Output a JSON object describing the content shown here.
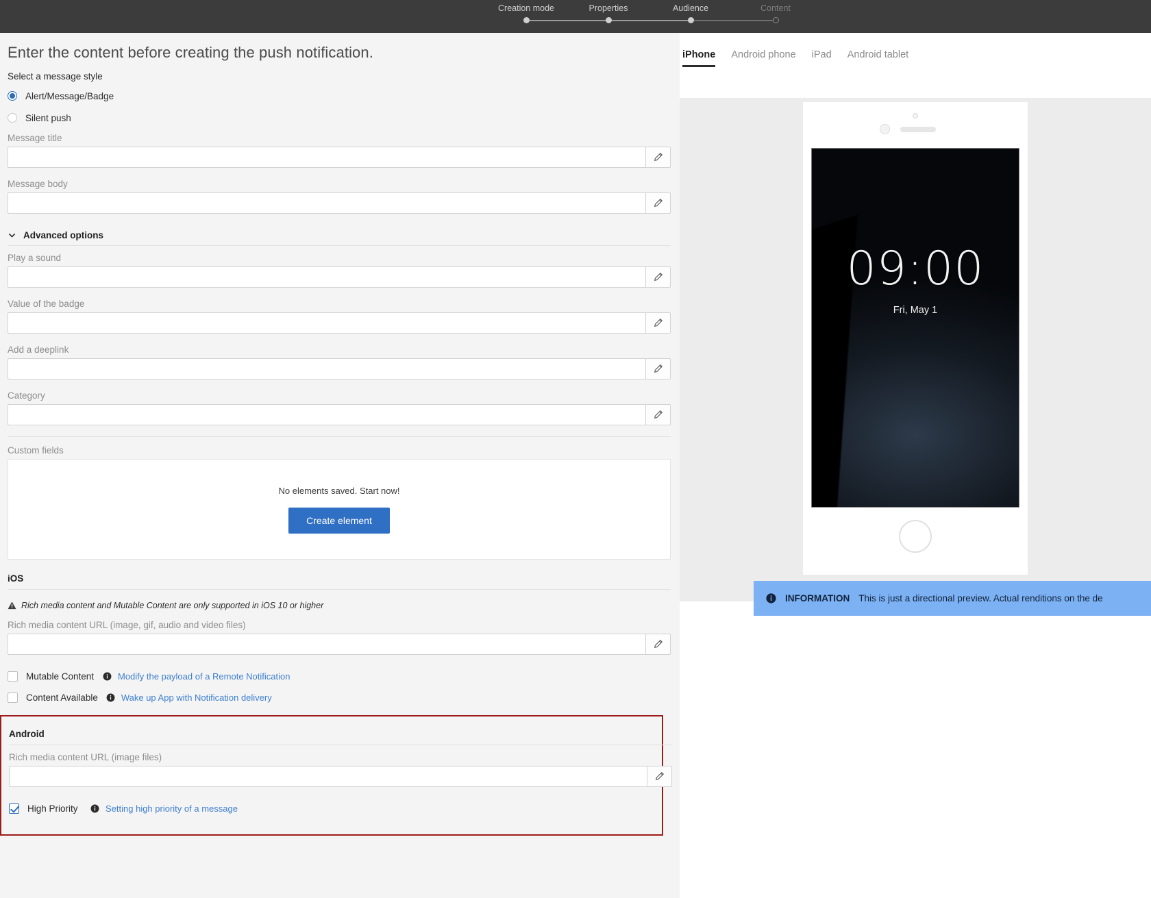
{
  "wizard": {
    "steps": [
      {
        "label": "Creation mode",
        "state": "done"
      },
      {
        "label": "Properties",
        "state": "done"
      },
      {
        "label": "Audience",
        "state": "done"
      },
      {
        "label": "Content",
        "state": "inactive"
      }
    ]
  },
  "form": {
    "heading": "Enter the content before creating the push notification.",
    "message_style": {
      "label": "Select a message style",
      "options": [
        {
          "label": "Alert/Message/Badge",
          "selected": true
        },
        {
          "label": "Silent push",
          "selected": false
        }
      ]
    },
    "message_title": {
      "label": "Message title",
      "value": ""
    },
    "message_body": {
      "label": "Message body",
      "value": ""
    },
    "advanced_options": {
      "label": "Advanced options",
      "expanded": true
    },
    "play_a_sound": {
      "label": "Play a sound",
      "value": ""
    },
    "value_of_the_badge": {
      "label": "Value of the badge",
      "value": ""
    },
    "add_a_deeplink": {
      "label": "Add a deeplink",
      "value": ""
    },
    "category": {
      "label": "Category",
      "value": ""
    },
    "custom_fields": {
      "label": "Custom fields",
      "empty_text": "No elements saved. Start now!",
      "create_button": "Create element"
    },
    "ios": {
      "title": "iOS",
      "warning": "Rich media content and Mutable Content are only supported in iOS 10 or higher",
      "rich_media_label": "Rich media content URL (image, gif, audio and video files)",
      "rich_media_value": "",
      "mutable_content": {
        "label": "Mutable Content",
        "checked": false,
        "link": "Modify the payload of a Remote Notification"
      },
      "content_available": {
        "label": "Content Available",
        "checked": false,
        "link": "Wake up App with Notification delivery"
      }
    },
    "android": {
      "title": "Android",
      "rich_media_label": "Rich media content URL (image files)",
      "rich_media_value": "",
      "high_priority": {
        "label": "High Priority",
        "checked": true,
        "link": "Setting high priority of a message"
      },
      "highlight_color": "#9e1b1b"
    }
  },
  "preview": {
    "tabs": [
      {
        "label": "iPhone",
        "active": true
      },
      {
        "label": "Android phone",
        "active": false
      },
      {
        "label": "iPad",
        "active": false
      },
      {
        "label": "Android tablet",
        "active": false
      }
    ],
    "device": {
      "lock_time": "09:00",
      "lock_date": "Fri, May 1"
    },
    "info_banner": {
      "label": "INFORMATION",
      "text": "This is just a directional preview. Actual renditions on the de"
    }
  },
  "colors": {
    "accent": "#2f6fc4",
    "link": "#3d7fd0",
    "topbar": "#3c3c3c",
    "banner": "#7cb1f3"
  }
}
